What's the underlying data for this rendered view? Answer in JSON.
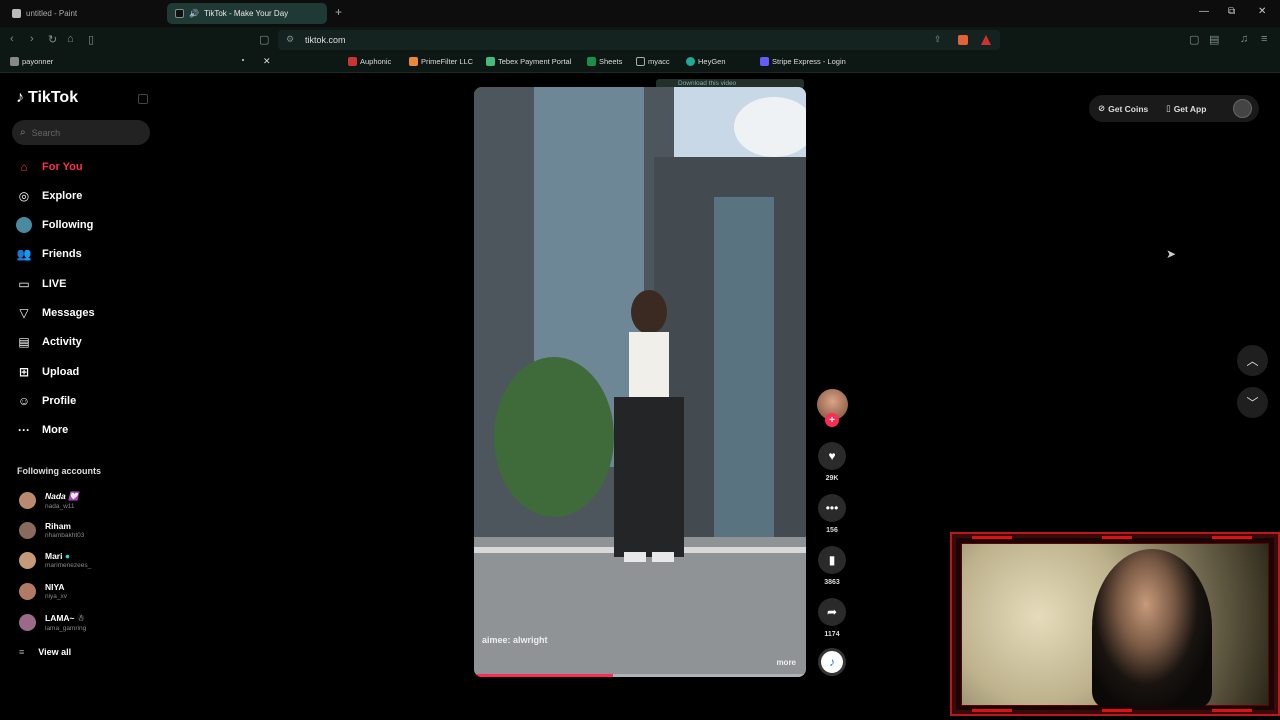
{
  "browser": {
    "tabs": [
      {
        "label": "untitled - Paint",
        "active": false
      },
      {
        "label": "TikTok - Make Your Day",
        "active": true
      }
    ],
    "url": "tiktok.com",
    "bookmarks": [
      "payonner",
      "Auphonic",
      "PrimeFilter LLC",
      "Tebex Payment Portal",
      "Sheets",
      "myacc",
      "HeyGen",
      "Stripe Express - Login"
    ]
  },
  "sidebar": {
    "logo": "TikTok",
    "search_placeholder": "Search",
    "nav": [
      {
        "label": "For You",
        "icon": "home-icon",
        "active": true
      },
      {
        "label": "Explore",
        "icon": "compass-icon",
        "active": false
      },
      {
        "label": "Following",
        "icon": "following-avatar-icon",
        "active": false
      },
      {
        "label": "Friends",
        "icon": "friends-icon",
        "active": false
      },
      {
        "label": "LIVE",
        "icon": "live-icon",
        "active": false
      },
      {
        "label": "Messages",
        "icon": "messages-icon",
        "active": false
      },
      {
        "label": "Activity",
        "icon": "activity-icon",
        "active": false
      },
      {
        "label": "Upload",
        "icon": "upload-icon",
        "active": false
      },
      {
        "label": "Profile",
        "icon": "profile-icon",
        "active": false
      },
      {
        "label": "More",
        "icon": "more-icon",
        "active": false
      }
    ],
    "following_header": "Following accounts",
    "accounts": [
      {
        "name": "Nada 💟",
        "handle": "nada_w11"
      },
      {
        "name": "Riham",
        "handle": "rihambakht03"
      },
      {
        "name": "Mari",
        "handle": "marimenezees_"
      },
      {
        "name": "NIYA",
        "handle": "niya_xv"
      },
      {
        "name": "LAMA~ ☃",
        "handle": "lama_gamring"
      }
    ],
    "view_all": "View all"
  },
  "video": {
    "download_banner": "Download this video",
    "caption": "aimee: alwright",
    "more": "more",
    "progress": 0.42
  },
  "actions": {
    "likes": "29K",
    "comments": "156",
    "saves": "3863",
    "shares": "1174"
  },
  "topbar": {
    "get_coins": "Get Coins",
    "get_app": "Get App"
  },
  "colors": {
    "accent": "#fe2c55",
    "active_tab": "#1f3a34",
    "webcam_frame": "#b8191d"
  }
}
